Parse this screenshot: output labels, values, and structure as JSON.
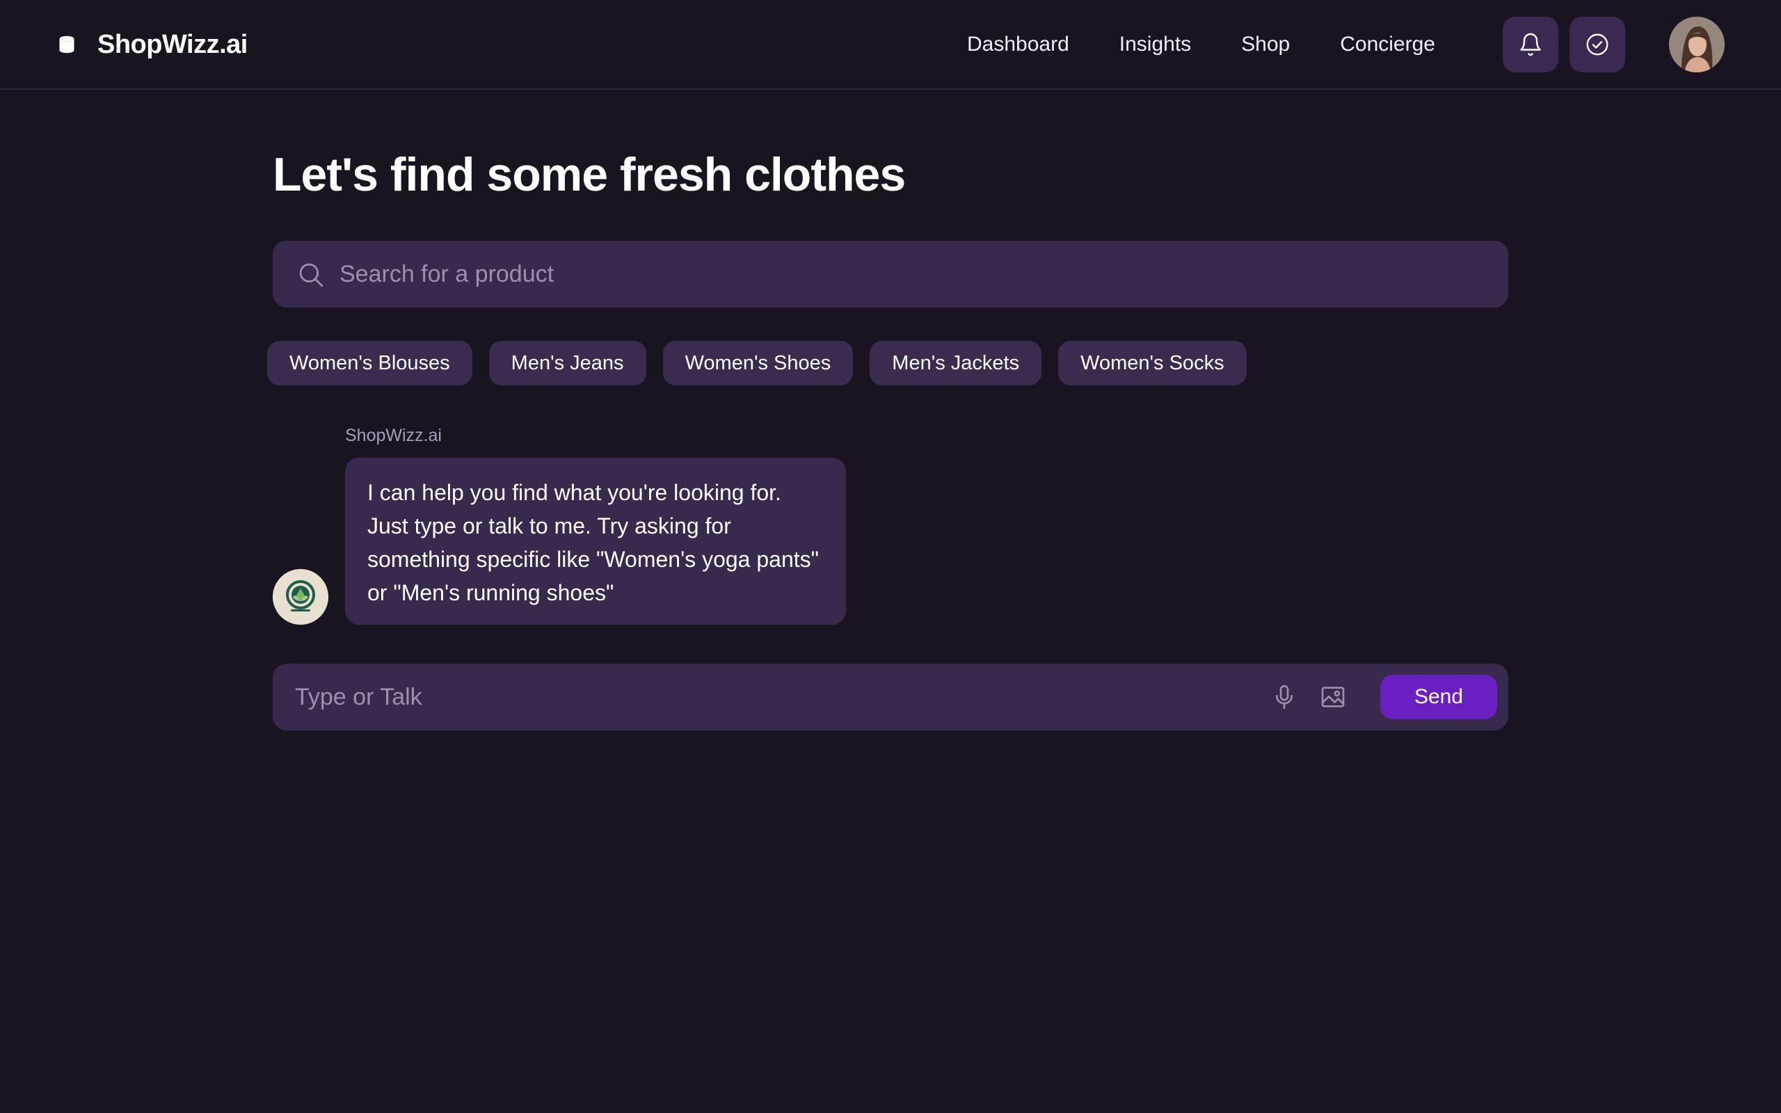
{
  "app": {
    "name": "ShopWizz.ai",
    "brand_icon": "database-icon"
  },
  "nav": {
    "items": [
      {
        "label": "Dashboard"
      },
      {
        "label": "Insights"
      },
      {
        "label": "Shop"
      },
      {
        "label": "Concierge"
      }
    ],
    "icons": [
      "bell-icon",
      "check-circle-icon"
    ],
    "avatar": "user-avatar"
  },
  "main": {
    "title": "Let's find some fresh clothes",
    "search": {
      "placeholder": "Search for a product",
      "value": ""
    },
    "chips": [
      {
        "label": "Women's Blouses"
      },
      {
        "label": "Men's Jeans"
      },
      {
        "label": "Women's Shoes"
      },
      {
        "label": "Men's Jackets"
      },
      {
        "label": "Women's Socks"
      }
    ],
    "conversation": {
      "sender": "ShopWizz.ai",
      "message": "I can help you find what you're looking for. Just type or talk to me. Try asking for something specific like \"Women's yoga pants\" or \"Men's running shoes\""
    },
    "chat": {
      "placeholder": "Type or Talk",
      "value": "",
      "send_label": "Send"
    }
  },
  "colors": {
    "background": "#1a1420",
    "surface": "#382a4c",
    "chip": "#3a2c4e",
    "accent": "#6a1fc2",
    "muted_text": "#9d90ad"
  }
}
